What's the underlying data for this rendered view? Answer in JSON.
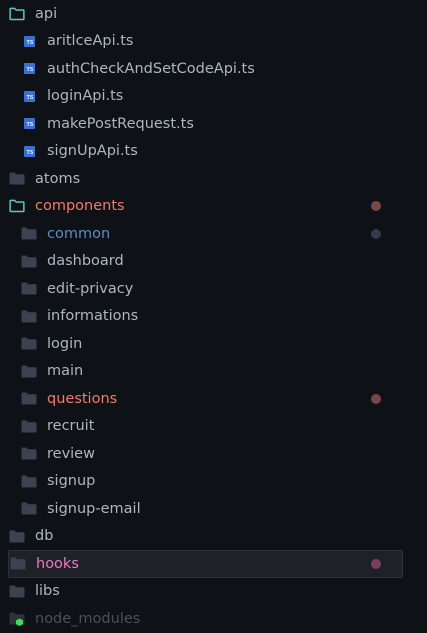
{
  "colors": {
    "background": "#0e1116",
    "text_default": "#aeb6c2",
    "text_error": "#f47a6a",
    "text_modified": "#5f8bc2",
    "text_hooks": "#ee76cf",
    "text_ignored": "#4a515c",
    "folder_closed": "#3b4252",
    "folder_open_outline": "#5fc7c7",
    "ts_icon": "#3b6fd4",
    "dot_error": "#7a4646",
    "dot_modified": "#2f3c4d",
    "dot_hooks": "#7a3e62",
    "selection_bg": "#1e2127",
    "green_badge": "#3fdc5a"
  },
  "tree": [
    {
      "label": "api",
      "icon": "folder-open-icon",
      "level": 0,
      "style": "default",
      "name": "folder-api"
    },
    {
      "label": "aritlceApi.ts",
      "icon": "typescript-file-icon",
      "icon_text": "TS",
      "level": 1,
      "style": "default",
      "name": "file-aritlceapi"
    },
    {
      "label": "authCheckAndSetCodeApi.ts",
      "icon": "typescript-file-icon",
      "icon_text": "TS",
      "level": 1,
      "style": "default",
      "name": "file-authcheckandsetcodeapi"
    },
    {
      "label": "loginApi.ts",
      "icon": "typescript-file-icon",
      "icon_text": "TS",
      "level": 1,
      "style": "default",
      "name": "file-loginapi"
    },
    {
      "label": "makePostRequest.ts",
      "icon": "typescript-file-icon",
      "icon_text": "TS",
      "level": 1,
      "style": "default",
      "name": "file-makepostrequest"
    },
    {
      "label": "signUpApi.ts",
      "icon": "typescript-file-icon",
      "icon_text": "TS",
      "level": 1,
      "style": "default",
      "name": "file-signupapi"
    },
    {
      "label": "atoms",
      "icon": "folder-icon",
      "level": 0,
      "style": "default",
      "name": "folder-atoms"
    },
    {
      "label": "components",
      "icon": "folder-open-icon",
      "level": 0,
      "style": "error",
      "dot": "error",
      "name": "folder-components"
    },
    {
      "label": "common",
      "icon": "folder-icon",
      "level": 1,
      "style": "modified",
      "dot": "modified",
      "name": "folder-common"
    },
    {
      "label": "dashboard",
      "icon": "folder-icon",
      "level": 1,
      "style": "default",
      "name": "folder-dashboard"
    },
    {
      "label": "edit-privacy",
      "icon": "folder-icon",
      "level": 1,
      "style": "default",
      "name": "folder-edit-privacy"
    },
    {
      "label": "informations",
      "icon": "folder-icon",
      "level": 1,
      "style": "default",
      "name": "folder-informations"
    },
    {
      "label": "login",
      "icon": "folder-icon",
      "level": 1,
      "style": "default",
      "name": "folder-login"
    },
    {
      "label": "main",
      "icon": "folder-icon",
      "level": 1,
      "style": "default",
      "name": "folder-main"
    },
    {
      "label": "questions",
      "icon": "folder-icon",
      "level": 1,
      "style": "error",
      "dot": "error",
      "name": "folder-questions"
    },
    {
      "label": "recruit",
      "icon": "folder-icon",
      "level": 1,
      "style": "default",
      "name": "folder-recruit"
    },
    {
      "label": "review",
      "icon": "folder-icon",
      "level": 1,
      "style": "default",
      "name": "folder-review"
    },
    {
      "label": "signup",
      "icon": "folder-icon",
      "level": 1,
      "style": "default",
      "name": "folder-signup"
    },
    {
      "label": "signup-email",
      "icon": "folder-icon",
      "level": 1,
      "style": "default",
      "name": "folder-signup-email"
    },
    {
      "label": "db",
      "icon": "folder-icon",
      "level": 0,
      "style": "default",
      "name": "folder-db"
    },
    {
      "label": "hooks",
      "icon": "folder-icon",
      "level": 0,
      "style": "hooks",
      "dot": "hooks",
      "selected": true,
      "name": "folder-hooks"
    },
    {
      "label": "libs",
      "icon": "folder-icon",
      "level": 0,
      "style": "default",
      "name": "folder-libs"
    },
    {
      "label": "node_modules",
      "icon": "folder-node-modules-icon",
      "level": 0,
      "style": "ignored",
      "name": "folder-node-modules"
    }
  ]
}
